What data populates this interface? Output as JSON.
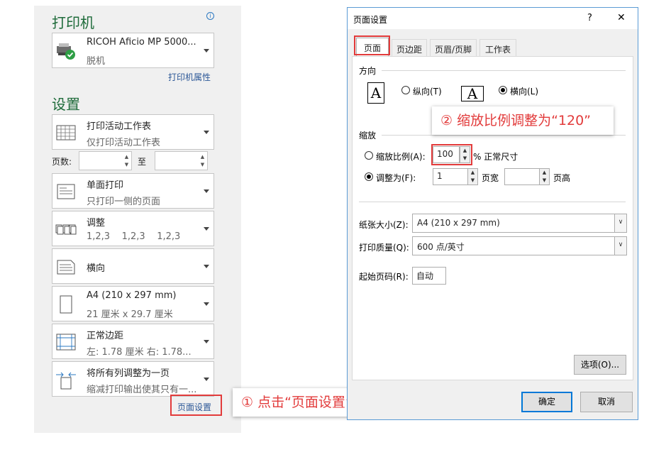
{
  "left_panel": {
    "printer_title": "打印机",
    "printer": {
      "name": "RICOH Aficio MP 5000...",
      "status": "脱机"
    },
    "printer_properties_link": "打印机属性",
    "settings_title": "设置",
    "options": [
      {
        "main": "打印活动工作表",
        "sub": "仅打印活动工作表"
      },
      {
        "main": "单面打印",
        "sub": "只打印一侧的页面"
      },
      {
        "main": "调整",
        "sub": "1,2,3    1,2,3    1,2,3"
      },
      {
        "main": "横向",
        "sub": ""
      },
      {
        "main": "A4 (210 x 297 mm)",
        "sub": "21 厘米 x 29.7 厘米"
      },
      {
        "main": "正常边距",
        "sub": "左: 1.78 厘米    右: 1.78..."
      },
      {
        "main": "将所有列调整为一页",
        "sub": "缩减打印输出使其只有一..."
      }
    ],
    "pages_label": "页数:",
    "pages_to_label": "至",
    "page_setup_link": "页面设置"
  },
  "callouts": {
    "step1": "①  点击“页面设置”",
    "step2": "②  缩放比例调整为“120”"
  },
  "dialog": {
    "title": "页面设置",
    "help": "?",
    "close": "✕",
    "tabs": [
      "页面",
      "页边距",
      "页眉/页脚",
      "工作表"
    ],
    "orientation_label": "方向",
    "portrait_label": "纵向(T)",
    "landscape_label": "横向(L)",
    "orientation_selected": "landscape",
    "scaling_label": "缩放",
    "scale_radio_label": "缩放比例(A):",
    "scale_value": "100",
    "scale_suffix": "% 正常尺寸",
    "fit_radio_label": "调整为(F):",
    "fit_wide_value": "1",
    "fit_wide_label": "页宽",
    "fit_tall_value": "",
    "fit_tall_label": "页高",
    "scaling_selected": "fit",
    "paper_size_label": "纸张大小(Z):",
    "paper_size_value": "A4 (210 x 297 mm)",
    "print_quality_label": "打印质量(Q):",
    "print_quality_value": "600 点/英寸",
    "first_page_label": "起始页码(R):",
    "first_page_value": "自动",
    "options_button": "选项(O)...",
    "ok_button": "确定",
    "cancel_button": "取消"
  },
  "colors": {
    "accent_green": "#1e6b3a",
    "callout_red": "#e23b3b",
    "link_blue": "#2b5797",
    "dialog_border": "#5b9bd5"
  }
}
